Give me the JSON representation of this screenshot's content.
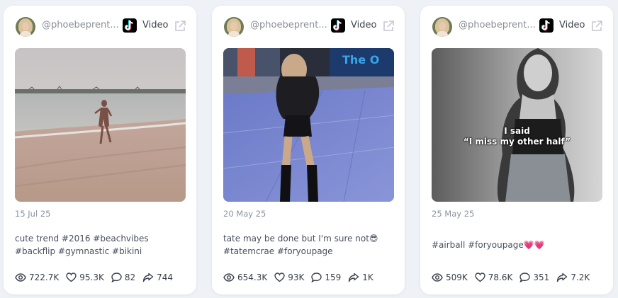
{
  "cards": [
    {
      "handle": "@phoebeprent...",
      "platform_icon": "tiktok-icon",
      "type_label": "Video",
      "date": "15 Jul 25",
      "caption": "cute trend #2016 #beachvibes #backflip #gymnastic #bikini",
      "overlay_text": "",
      "stats": {
        "views": "722.7K",
        "likes": "95.3K",
        "comments": "82",
        "shares": "744"
      }
    },
    {
      "handle": "@phoebeprent...",
      "platform_icon": "tiktok-icon",
      "type_label": "Video",
      "date": "20 May 25",
      "caption": "tate may be done but I'm sure not😎 #tatemcrae #foryoupage",
      "overlay_text": "",
      "stats": {
        "views": "654.3K",
        "likes": "93K",
        "comments": "159",
        "shares": "1K"
      }
    },
    {
      "handle": "@phoebeprent...",
      "platform_icon": "tiktok-icon",
      "type_label": "Video",
      "date": "25 May 25",
      "caption": "#airball #foryoupage💗💗",
      "overlay_text": "I said\n“I miss my other half”",
      "stats": {
        "views": "509K",
        "likes": "78.6K",
        "comments": "351",
        "shares": "7.2K"
      }
    }
  ]
}
